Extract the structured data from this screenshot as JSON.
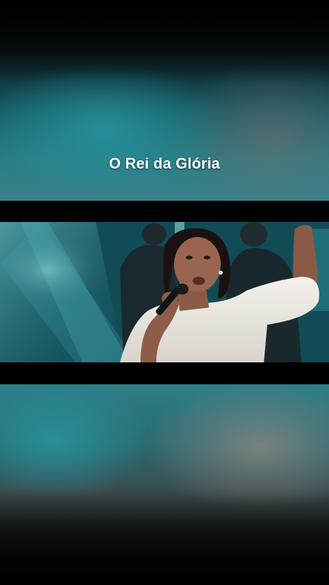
{
  "video": {
    "title": "O Rei da Glória",
    "scene": "singer-with-microphone-on-stage"
  },
  "colors": {
    "stage_teal": "#1b6e78",
    "letterbox": "#000000",
    "title_text": "#ffffff"
  }
}
